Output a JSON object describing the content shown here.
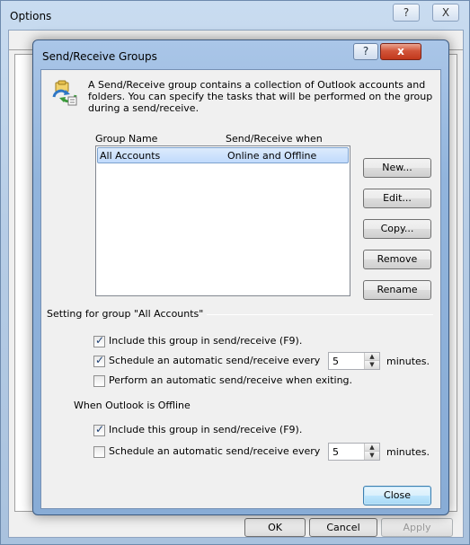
{
  "options_window": {
    "title": "Options",
    "help_glyph": "?",
    "close_glyph": "X",
    "ok_label": "OK",
    "cancel_label": "Cancel",
    "apply_label": "Apply"
  },
  "dialog": {
    "title": "Send/Receive Groups",
    "help_glyph": "?",
    "close_glyph": "x",
    "icon": "send-receive-groups-icon",
    "intro": "A Send/Receive group contains a collection of Outlook accounts and folders. You can specify the tasks that will be performed on the group during a send/receive.",
    "columns": {
      "group_name": "Group Name",
      "when": "Send/Receive when"
    },
    "groups": [
      {
        "name": "All Accounts",
        "when": "Online and Offline"
      }
    ],
    "buttons": {
      "new": "New...",
      "edit": "Edit...",
      "copy": "Copy...",
      "remove": "Remove",
      "rename": "Rename",
      "close": "Close"
    },
    "online_section": {
      "label": "Setting for group \"All Accounts\"",
      "include_label": "Include this group in send/receive (F9).",
      "include_checked": true,
      "schedule_label": "Schedule an automatic send/receive every",
      "schedule_checked": true,
      "schedule_minutes": "5",
      "minutes_label": "minutes.",
      "exit_label": "Perform an automatic send/receive when exiting.",
      "exit_checked": false
    },
    "offline_section": {
      "label": "When Outlook is Offline",
      "include_label": "Include this group in send/receive (F9).",
      "include_checked": true,
      "schedule_label": "Schedule an automatic send/receive every",
      "schedule_checked": false,
      "schedule_minutes": "5",
      "minutes_label": "minutes."
    }
  }
}
